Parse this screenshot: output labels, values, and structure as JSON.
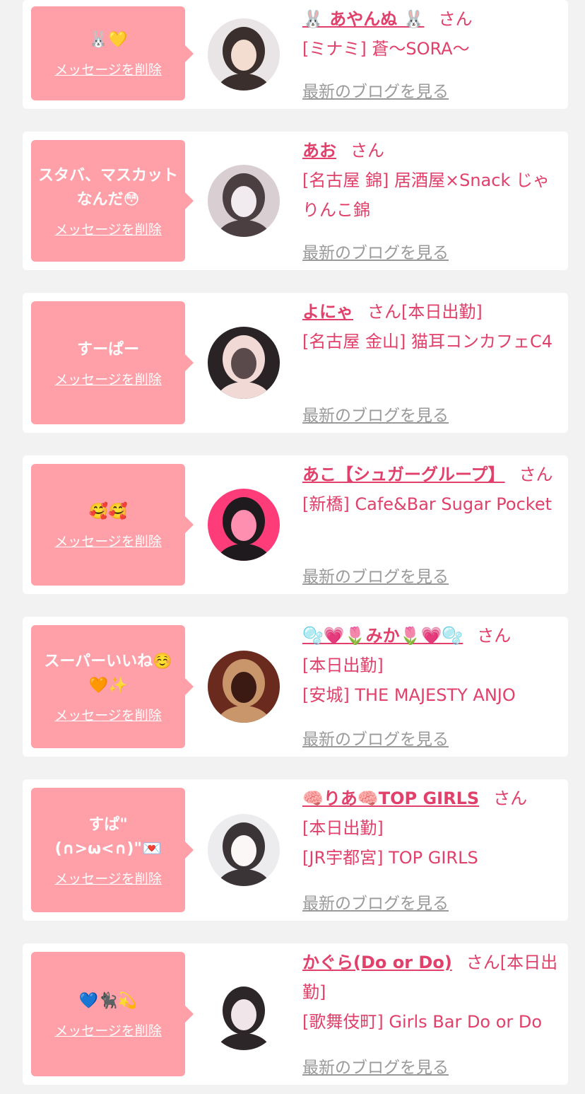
{
  "entries": [
    {
      "message": "🐰💛",
      "delete_label": "メッセージを削除",
      "name": "🐰 あやんぬ 🐰",
      "honorific": "さん",
      "shop_lines": [
        "[ミナミ] 蒼〜SORA〜"
      ],
      "blog_label": "最新のブログを見る",
      "avatar_colors": [
        "#e9e4e6",
        "#3a2f2c",
        "#f3dcd0"
      ]
    },
    {
      "message": "スタバ、マスカットなんだ😳",
      "delete_label": "メッセージを削除",
      "name": "あお",
      "honorific": "さん",
      "shop_lines": [
        "[名古屋 錦] 居酒屋×Snack じゃりんこ錦"
      ],
      "blog_label": "最新のブログを見る",
      "avatar_colors": [
        "#d9cfd3",
        "#4b3f42",
        "#f1ebef"
      ]
    },
    {
      "message": "すーぱー",
      "delete_label": "メッセージを削除",
      "name": "よにゃ",
      "honorific": "さん[本日出勤]",
      "shop_lines": [
        "[名古屋 金山] 猫耳コンカフェC4"
      ],
      "blog_label": "最新のブログを見る",
      "avatar_colors": [
        "#2a2326",
        "#f1d9d6",
        "#5a4a4c"
      ]
    },
    {
      "message": "🥰🥰",
      "delete_label": "メッセージを削除",
      "name": "あこ【シュガーグループ】",
      "honorific": "さん",
      "shop_lines": [
        "[新橋] Cafe&Bar Sugar Pocket"
      ],
      "blog_label": "最新のブログを見る",
      "avatar_colors": [
        "#ff3c7a",
        "#1e1a1e",
        "#ff8fb0"
      ]
    },
    {
      "message": "スーパーいいね☺️🧡✨",
      "delete_label": "メッセージを削除",
      "name": "🫧💗🌷みか🌷💗🫧",
      "honorific": "さん",
      "shop_lines": [
        "[本日出勤]",
        "[安城] THE MAJESTY ANJO"
      ],
      "blog_label": "最新のブログを見る",
      "avatar_colors": [
        "#6b2a1e",
        "#c9956b",
        "#3a1a12"
      ]
    },
    {
      "message": "すぱ\"(∩>ω<∩)\"💌",
      "delete_label": "メッセージを削除",
      "name": "🧠りあ🧠TOP GIRLS",
      "honorific": "さん",
      "shop_lines": [
        "[本日出勤]",
        "[JR宇都宮] TOP GIRLS"
      ],
      "blog_label": "最新のブログを見る",
      "avatar_colors": [
        "#ecebee",
        "#3a3436",
        "#fbf7f7"
      ]
    },
    {
      "message": "💙🐈‍⬛💫",
      "delete_label": "メッセージを削除",
      "name": "かぐら(Do or Do)",
      "honorific": "さん[本日出勤]",
      "shop_lines": [
        "[歌舞伎町] Girls Bar Do or Do"
      ],
      "blog_label": "最新のブログを見る",
      "avatar_colors": [
        "#ffffff",
        "#2c2628",
        "#f0e6ea"
      ]
    }
  ]
}
